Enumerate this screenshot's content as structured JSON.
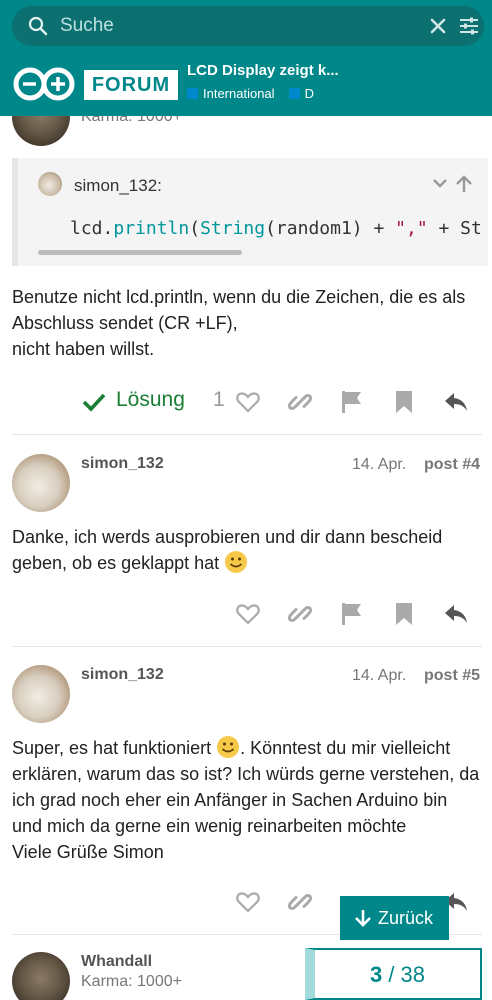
{
  "search": {
    "placeholder": "Suche"
  },
  "header": {
    "logo_text": "FORUM",
    "thread_title": "LCD Display zeigt k...",
    "category": "International",
    "subcategory": "D"
  },
  "post3": {
    "karma": "Karma: 1000+",
    "quote_user": "simon_132:",
    "code": {
      "a": "lcd.",
      "fn1": "println",
      "b": "(",
      "fn2": "String",
      "c": "(random1) + ",
      "s1": "\",\"",
      "d": " + St"
    },
    "text": "Benutze nicht lcd.println, wenn du die Zeichen, die es als Abschluss sendet (CR +LF),",
    "text2": "nicht haben willst.",
    "solution_label": "Lösung",
    "like_count": "1"
  },
  "post4": {
    "username": "simon_132",
    "date": "14. Apr.",
    "post_number": "post #4",
    "text": "Danke, ich werds ausprobieren und dir dann bescheid geben, ob es geklappt hat"
  },
  "post5": {
    "username": "simon_132",
    "date": "14. Apr.",
    "post_number": "post #5",
    "text_a": "Super, es hat funktioniert",
    "text_b": ". Könntest du mir vielleicht erklären, warum das so ist? Ich würds gerne verstehen, da ich grad noch eher ein Anfänger in Sachen Arduino bin und mich da gerne ein wenig reinarbeiten möchte",
    "text_c": "Viele Grüße Simon"
  },
  "post6": {
    "username": "Whandall",
    "karma": "Karma: 1000+"
  },
  "back_button": {
    "label": "Zurück"
  },
  "progress": {
    "current": "3",
    "total": "/ 38"
  },
  "colors": {
    "brand": "#00878a",
    "solution": "#1a7f35",
    "category": "#0088cc"
  },
  "icons": [
    "search-icon",
    "clear-icon",
    "filter-icon",
    "arduino-logo-icon",
    "check-icon",
    "heart-icon",
    "link-icon",
    "flag-icon",
    "bookmark-icon",
    "reply-icon",
    "chevron-down-icon",
    "arrow-up-icon",
    "arrow-down-icon",
    "smile-emoji-icon"
  ]
}
